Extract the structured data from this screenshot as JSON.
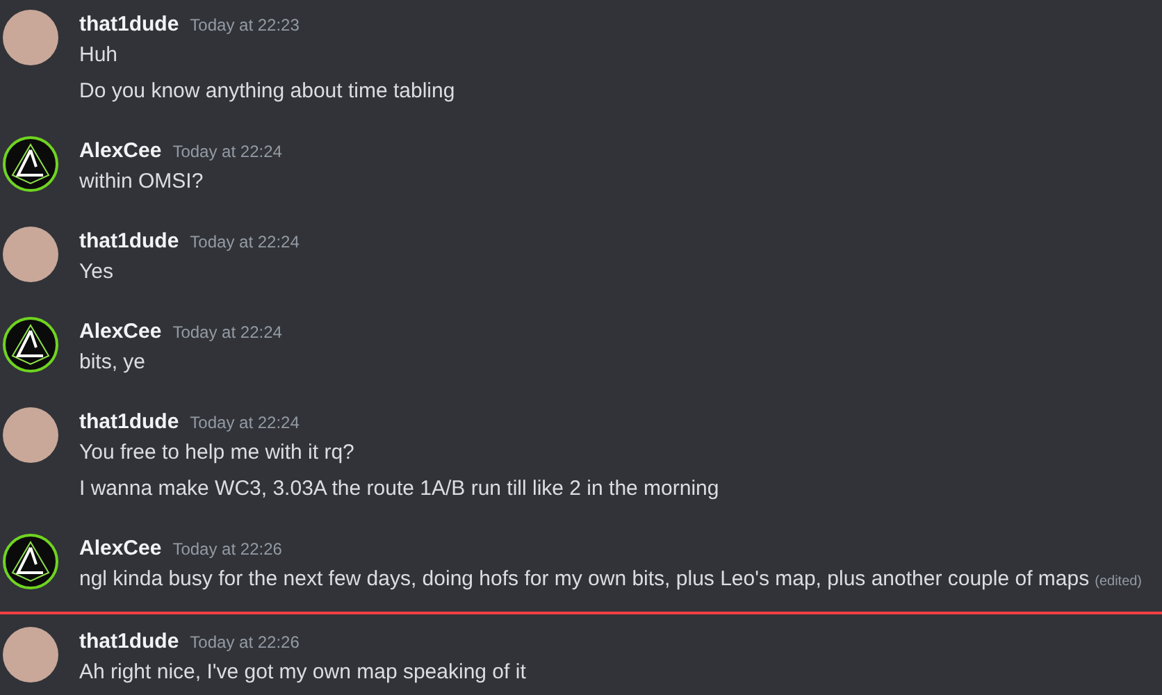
{
  "feed": [
    {
      "kind": "group",
      "author": "that1dude",
      "avatar": {
        "kind": "photo"
      },
      "timestamp": "Today at 22:23",
      "messages": [
        {
          "text": "Huh"
        },
        {
          "text": "Do you know anything about time tabling"
        }
      ]
    },
    {
      "kind": "group",
      "author": "AlexCee",
      "avatar": {
        "kind": "logo"
      },
      "timestamp": "Today at 22:24",
      "messages": [
        {
          "text": "within OMSI?"
        }
      ]
    },
    {
      "kind": "group",
      "author": "that1dude",
      "avatar": {
        "kind": "photo"
      },
      "timestamp": "Today at 22:24",
      "messages": [
        {
          "text": "Yes"
        }
      ]
    },
    {
      "kind": "group",
      "author": "AlexCee",
      "avatar": {
        "kind": "logo"
      },
      "timestamp": "Today at 22:24",
      "messages": [
        {
          "text": "bits, ye"
        }
      ]
    },
    {
      "kind": "group",
      "author": "that1dude",
      "avatar": {
        "kind": "photo"
      },
      "timestamp": "Today at 22:24",
      "messages": [
        {
          "text": "You free to help me with it rq?"
        },
        {
          "text": "I wanna make WC3, 3.03A the route 1A/B run till like 2 in the morning"
        }
      ]
    },
    {
      "kind": "group",
      "author": "AlexCee",
      "avatar": {
        "kind": "logo"
      },
      "timestamp": "Today at 22:26",
      "messages": [
        {
          "text": "ngl kinda busy for the next few days, doing hofs for my own bits, plus Leo's map, plus another couple of maps",
          "edited_label": "(edited)"
        }
      ]
    },
    {
      "kind": "divider"
    },
    {
      "kind": "group",
      "author": "that1dude",
      "avatar": {
        "kind": "photo"
      },
      "timestamp": "Today at 22:26",
      "messages": [
        {
          "text": "Ah right nice, I've got my own map speaking of it"
        }
      ]
    }
  ]
}
